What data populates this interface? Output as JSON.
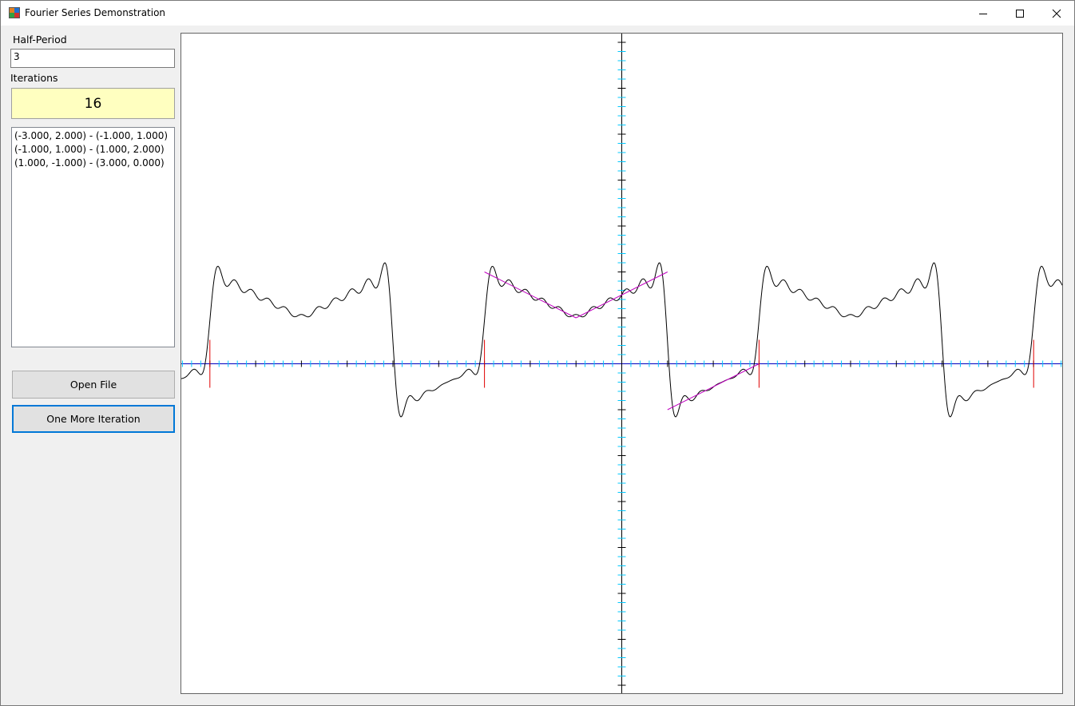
{
  "window": {
    "title": "Fourier Series Demonstration"
  },
  "form": {
    "half_period_label": "Half-Period",
    "half_period_value": "3",
    "iterations_label": "Iterations",
    "iterations_value": "16",
    "segments": [
      "(-3.000, 2.000) - (-1.000, 1.000)",
      "(-1.000, 1.000) - (1.000, 2.000)",
      "(1.000, -1.000) - (3.000, 0.000)"
    ],
    "open_file_label": "Open File",
    "one_more_label": "One More Iteration"
  },
  "chart_data": {
    "type": "line",
    "half_period": 3,
    "harmonics": 16,
    "segments": [
      {
        "x1": -3,
        "y1": 2,
        "x2": -1,
        "y2": 1
      },
      {
        "x1": -1,
        "y1": 1,
        "x2": 1,
        "y2": 2
      },
      {
        "x1": 1,
        "y1": -1,
        "x2": 3,
        "y2": 0
      }
    ],
    "xlim": [
      -9.6,
      9.6
    ],
    "ylim": [
      -7,
      7
    ],
    "colors": {
      "series": "#000000",
      "segments": "#c000c0",
      "period_markers": "#e00000",
      "x_axis": "#0000c0",
      "y_axis": "#000000",
      "minor_ticks": "#00c8ff",
      "major_ticks": "#000000"
    }
  }
}
